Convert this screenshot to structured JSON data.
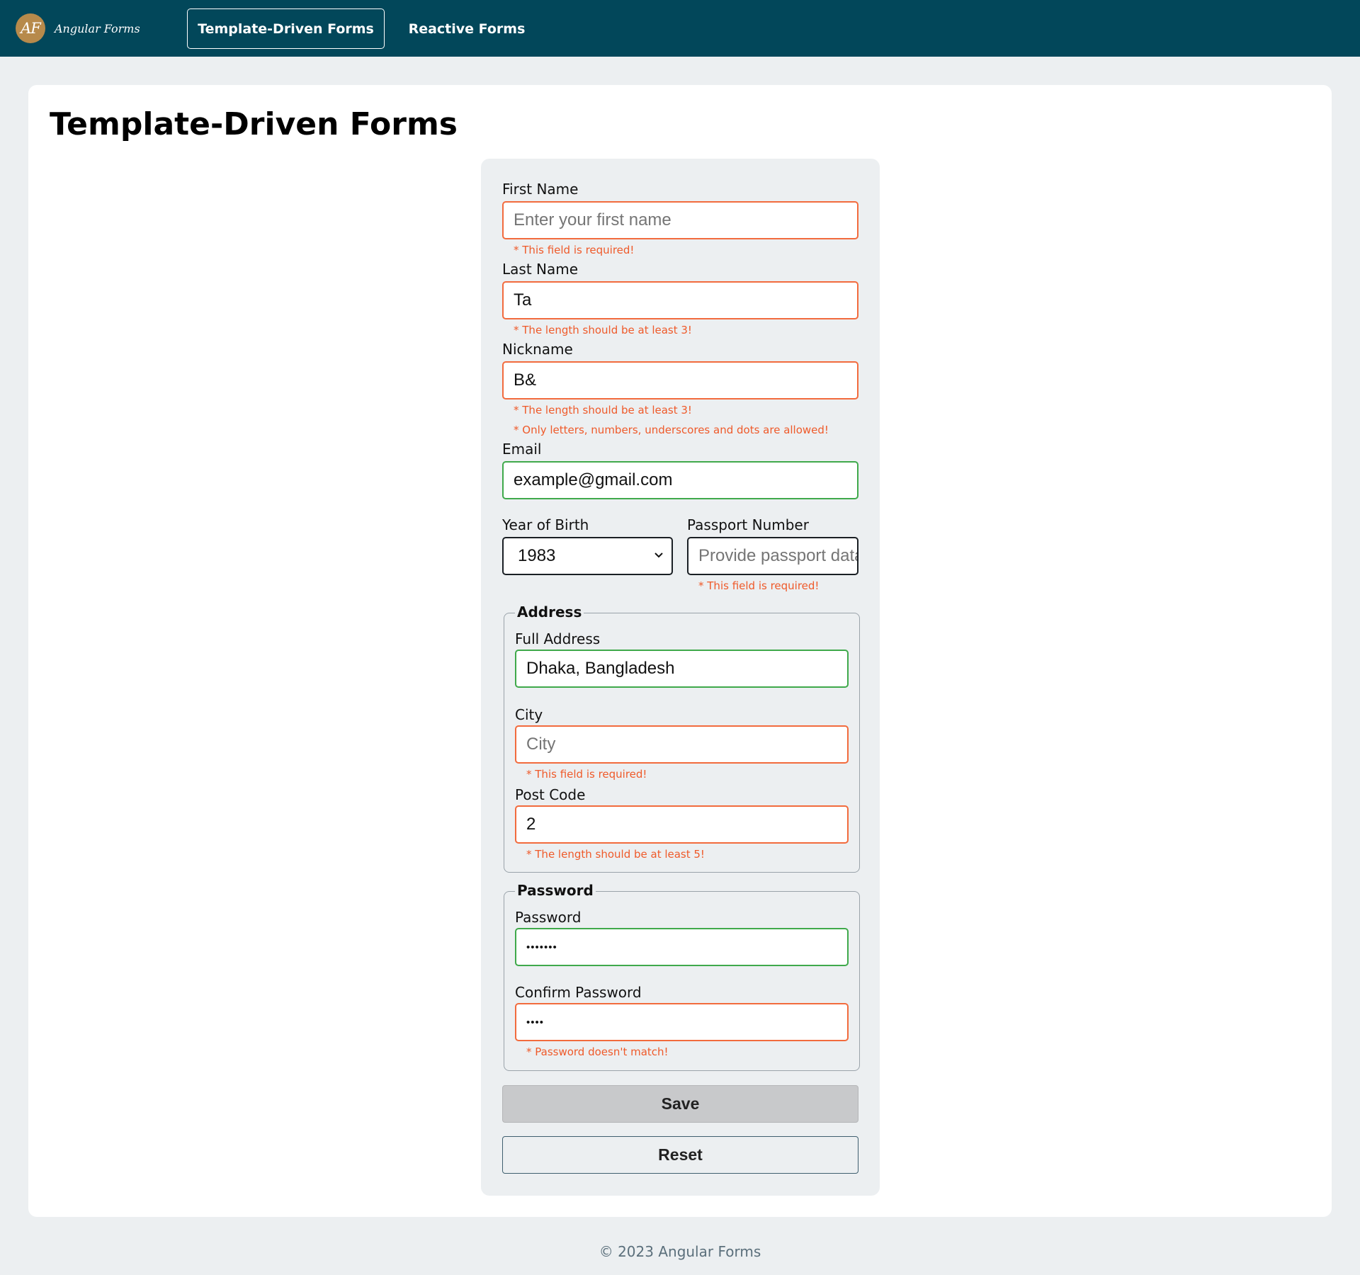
{
  "nav": {
    "logo_text": "AF",
    "brand_name": "Angular Forms",
    "tabs": [
      {
        "label": "Template-Driven Forms",
        "active": true
      },
      {
        "label": "Reactive Forms",
        "active": false
      }
    ]
  },
  "page": {
    "title": "Template-Driven Forms"
  },
  "form": {
    "first_name": {
      "label": "First Name",
      "placeholder": "Enter your first name",
      "value": "",
      "error": "* This field is required!"
    },
    "last_name": {
      "label": "Last Name",
      "value": "Ta",
      "error": "* The length should be at least 3!"
    },
    "nickname": {
      "label": "Nickname",
      "value": "B&",
      "errors": [
        "* The length should be at least 3!",
        "* Only letters, numbers, underscores and dots are allowed!"
      ]
    },
    "email": {
      "label": "Email",
      "value": "example@gmail.com"
    },
    "year_of_birth": {
      "label": "Year of Birth",
      "selected": "1983"
    },
    "passport": {
      "label": "Passport Number",
      "placeholder": "Provide passport data",
      "value": "",
      "error": "* This field is required!"
    },
    "address": {
      "legend": "Address",
      "full_address": {
        "label": "Full Address",
        "value": "Dhaka, Bangladesh"
      },
      "city": {
        "label": "City",
        "placeholder": "City",
        "value": "",
        "error": "* This field is required!"
      },
      "post_code": {
        "label": "Post Code",
        "value": "2",
        "error": "* The length should be at least 5!"
      }
    },
    "password_group": {
      "legend": "Password",
      "password": {
        "label": "Password",
        "masked": "•••••••"
      },
      "confirm": {
        "label": "Confirm Password",
        "masked": "••••",
        "error": "* Password doesn't match!"
      }
    },
    "buttons": {
      "save": "Save",
      "reset": "Reset"
    }
  },
  "footer": {
    "text": "© 2023 Angular Forms"
  },
  "colors": {
    "nav_bg": "#02475a",
    "error": "#ef5a2a",
    "valid_border": "#3fa94b",
    "logo": "#b78a4b"
  }
}
